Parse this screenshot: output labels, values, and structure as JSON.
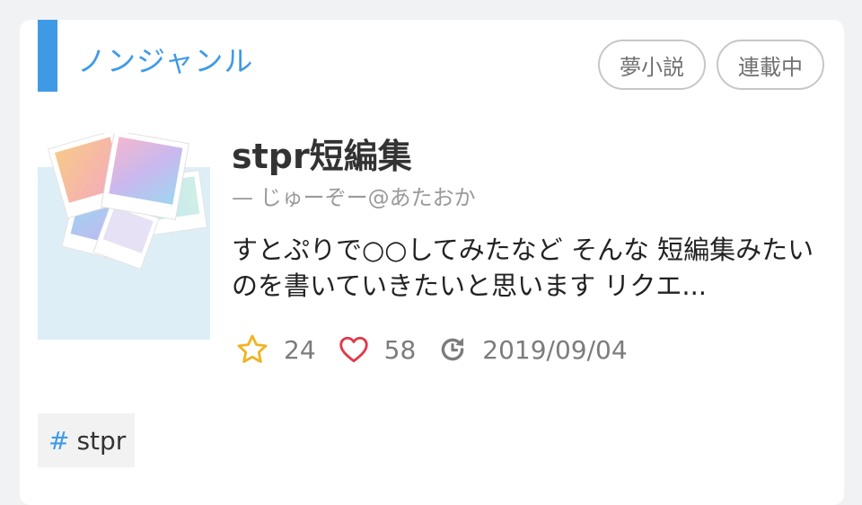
{
  "genre": {
    "label": "ノンジャンル",
    "accent_color": "#3f9ae6"
  },
  "badges": [
    {
      "label": "夢小説"
    },
    {
      "label": "連載中"
    }
  ],
  "novel": {
    "title": "stpr短編集",
    "author": "— じゅーぞー@あたおか",
    "description": "すとぷりで○○してみたなど そんな 短編集みたいのを書いていきたいと思います リクエ...",
    "thumbnail_icon": "polaroid-collage-image"
  },
  "stats": {
    "stars": "24",
    "likes": "58",
    "updated": "2019/09/04",
    "star_icon": "star-icon",
    "heart_icon": "heart-icon",
    "update_icon": "update-icon",
    "star_color": "#f0b323",
    "heart_color": "#e0394a"
  },
  "tags": [
    {
      "hash": "#",
      "label": "stpr"
    }
  ]
}
